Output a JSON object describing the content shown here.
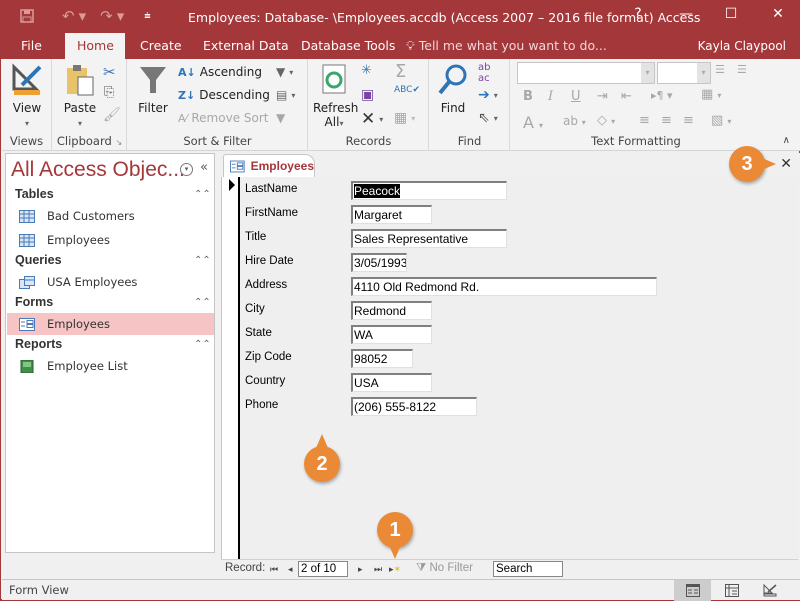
{
  "titlebar": {
    "title": "Employees: Database- \\Employees.accdb (Access 2007 – 2016 file format) Access",
    "help": "?",
    "minimize": "—",
    "maximize": "☐",
    "close": "✕"
  },
  "ribbon_tabs": [
    {
      "label": "File"
    },
    {
      "label": "Home",
      "active": true
    },
    {
      "label": "Create"
    },
    {
      "label": "External Data"
    },
    {
      "label": "Database Tools"
    }
  ],
  "tell_me": "Tell me what you want to do...",
  "user_name": "Kayla Claypool",
  "ribbon": {
    "views": {
      "label": "Views",
      "view_button": "View"
    },
    "clipboard": {
      "label": "Clipboard",
      "paste_button": "Paste"
    },
    "sort_filter": {
      "label": "Sort & Filter",
      "filter_button": "Filter",
      "ascending": "Ascending",
      "descending": "Descending",
      "remove_sort": "Remove Sort"
    },
    "records": {
      "label": "Records",
      "refresh_button": "Refresh",
      "refresh_all": "All"
    },
    "find": {
      "label": "Find",
      "find_button": "Find"
    },
    "text_formatting": {
      "label": "Text Formatting",
      "font_name": "",
      "font_size": ""
    }
  },
  "nav_pane": {
    "title": "All Access Objec...",
    "sections": [
      {
        "label": "Tables",
        "items": [
          "Bad Customers",
          "Employees"
        ]
      },
      {
        "label": "Queries",
        "items": [
          "USA Employees"
        ]
      },
      {
        "label": "Forms",
        "items": [
          "Employees"
        ],
        "selected": "Employees"
      },
      {
        "label": "Reports",
        "items": [
          "Employee List"
        ]
      }
    ]
  },
  "document": {
    "tab_label": "Employees",
    "fields": [
      {
        "label": "LastName",
        "value": "Peacock"
      },
      {
        "label": "FirstName",
        "value": "Margaret"
      },
      {
        "label": "Title",
        "value": "Sales Representative"
      },
      {
        "label": "Hire Date",
        "value": "3/05/1993"
      },
      {
        "label": "Address",
        "value": "4110 Old Redmond Rd."
      },
      {
        "label": "City",
        "value": "Redmond"
      },
      {
        "label": "State",
        "value": "WA"
      },
      {
        "label": "Zip Code",
        "value": "98052"
      },
      {
        "label": "Country",
        "value": "USA"
      },
      {
        "label": "Phone",
        "value": "(206) 555-8122"
      }
    ]
  },
  "record_nav": {
    "label": "Record:",
    "current": "2 of 10",
    "filter_status": "No Filter",
    "search_value": "Search"
  },
  "status_bar": {
    "text": "Form View"
  },
  "callouts": [
    "1",
    "2",
    "3"
  ],
  "colors": {
    "accent": "#a4373a",
    "callout": "#ea8a37",
    "nav_selected": "#f6c4c5"
  }
}
